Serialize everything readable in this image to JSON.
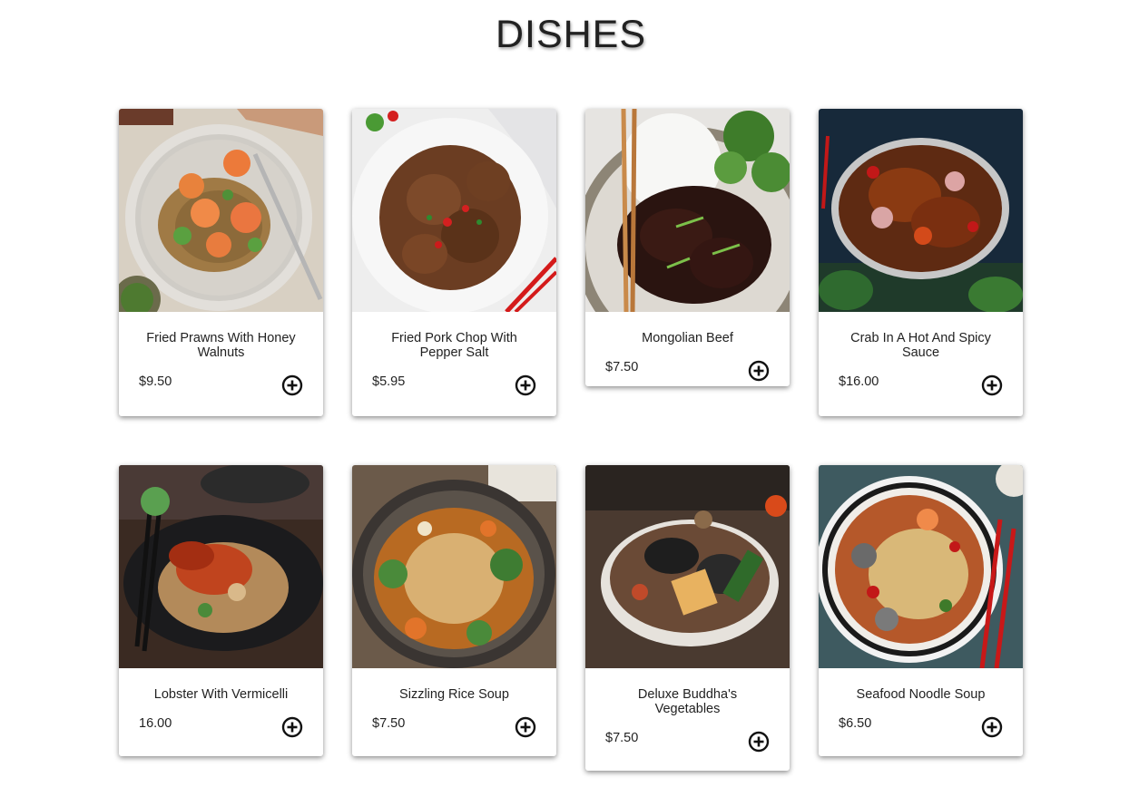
{
  "page": {
    "title": "DISHES"
  },
  "dishes": [
    {
      "name": "Fried Prawns With Honey Walnuts",
      "price": "$9.50",
      "image": "fried-prawns-image"
    },
    {
      "name": "Fried Pork Chop With Pepper Salt",
      "price": "$5.95",
      "image": "pork-chop-image"
    },
    {
      "name": "Mongolian Beef",
      "price": "$7.50",
      "image": "mongolian-beef-image"
    },
    {
      "name": "Crab In A Hot And Spicy Sauce",
      "price": "$16.00",
      "image": "spicy-crab-image"
    },
    {
      "name": "Lobster With Vermicelli",
      "price": "16.00",
      "image": "lobster-vermicelli-image"
    },
    {
      "name": "Sizzling Rice Soup",
      "price": "$7.50",
      "image": "sizzling-rice-soup-image"
    },
    {
      "name": "Deluxe Buddha's Vegetables",
      "price": "$7.50",
      "image": "buddha-vegetables-image"
    },
    {
      "name": "Seafood Noodle Soup",
      "price": "$6.50",
      "image": "seafood-noodle-soup-image"
    }
  ],
  "icons": {
    "add": "plus-circle-icon"
  },
  "colors": {
    "background": "#ffffff",
    "text": "#222222",
    "icon": "#111111"
  }
}
